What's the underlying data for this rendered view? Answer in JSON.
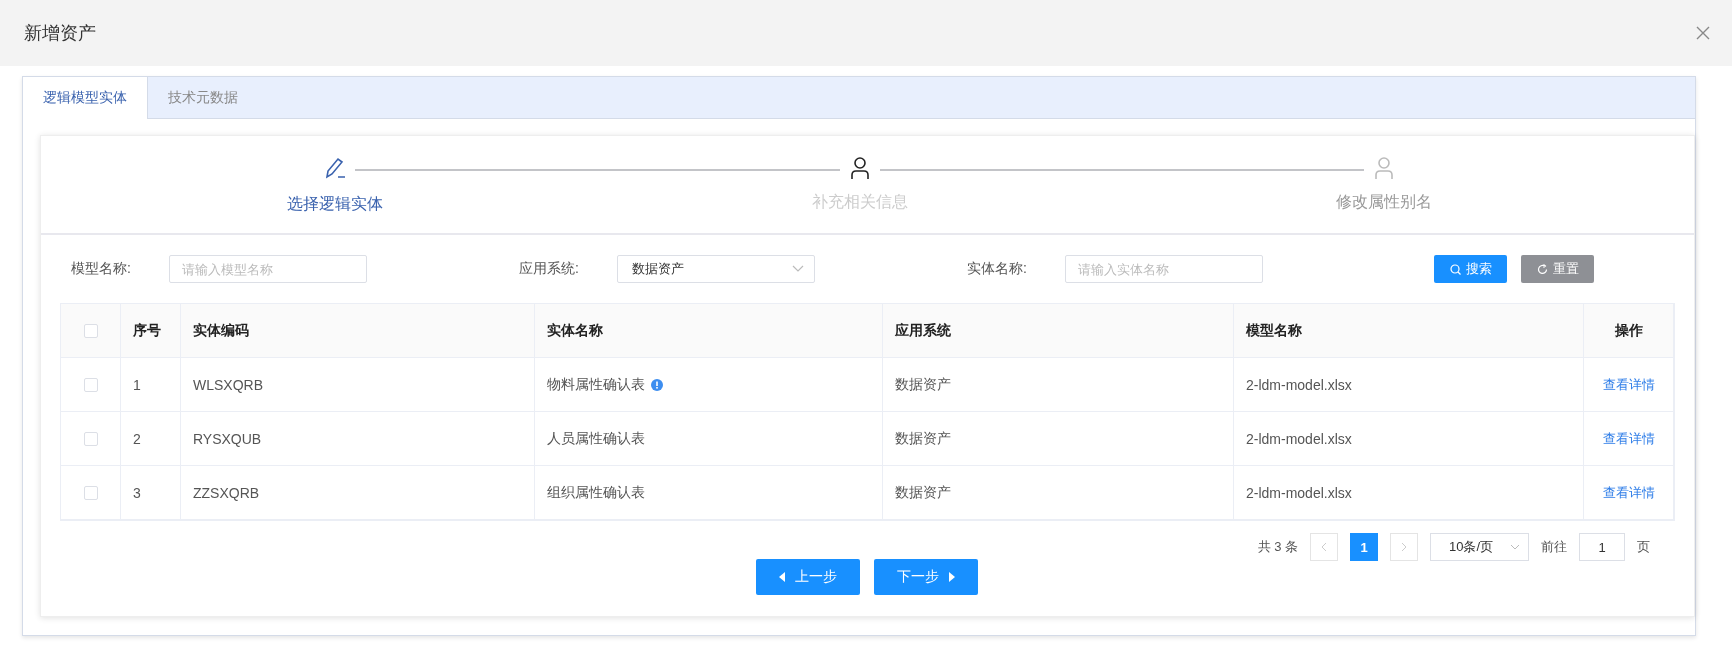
{
  "dialog": {
    "title": "新增资产"
  },
  "tabs": [
    {
      "label": "逻辑模型实体",
      "selected": true
    },
    {
      "label": "技术元数据",
      "selected": false
    }
  ],
  "steps": [
    {
      "label": "选择逻辑实体",
      "selected": true,
      "dimmed": false,
      "kind": "edit"
    },
    {
      "label": "补充相关信息",
      "selected": false,
      "dimmed": false,
      "kind": "person"
    },
    {
      "label": "修改属性别名",
      "selected": false,
      "dimmed": true,
      "kind": "person"
    }
  ],
  "filters": [
    {
      "label": "模型名称:",
      "kind": "input",
      "placeholder": "请输入模型名称"
    },
    {
      "label": "应用系统:",
      "kind": "select",
      "value": "数据资产"
    },
    {
      "label": "实体名称:",
      "kind": "input",
      "placeholder": "请输入实体名称"
    }
  ],
  "actions": [
    {
      "label": "搜索",
      "kind": "search"
    },
    {
      "label": "重置",
      "kind": "reset"
    }
  ],
  "table": {
    "select_all": {
      "checked": false
    },
    "columns": [
      "序号",
      "实体编码",
      "实体名称",
      "应用系统",
      "模型名称",
      "操作"
    ],
    "rows": [
      {
        "checked": false,
        "cells": [
          "1",
          "WLSXQRB",
          "物料属性确认表",
          "数据资产",
          "2-ldm-model.xlsx"
        ],
        "info": true,
        "action": "查看详情"
      },
      {
        "checked": false,
        "cells": [
          "2",
          "RYSXQUB",
          "人员属性确认表",
          "数据资产",
          "2-ldm-model.xlsx"
        ],
        "info": false,
        "action": "查看详情"
      },
      {
        "checked": false,
        "cells": [
          "3",
          "ZZSXQRB",
          "组织属性确认表",
          "数据资产",
          "2-ldm-model.xlsx"
        ],
        "info": false,
        "action": "查看详情"
      }
    ]
  },
  "pagination": {
    "total": "共 3 条",
    "prev_disabled": true,
    "pages": [
      {
        "label": "1",
        "selected": true
      }
    ],
    "next_disabled": true,
    "page_size": "10条/页",
    "goto_label": "前往",
    "goto_value": "1",
    "goto_suffix": "页"
  },
  "nav_buttons": [
    {
      "label": "上一步",
      "kind": "prev"
    },
    {
      "label": "下一步",
      "kind": "next"
    }
  ]
}
